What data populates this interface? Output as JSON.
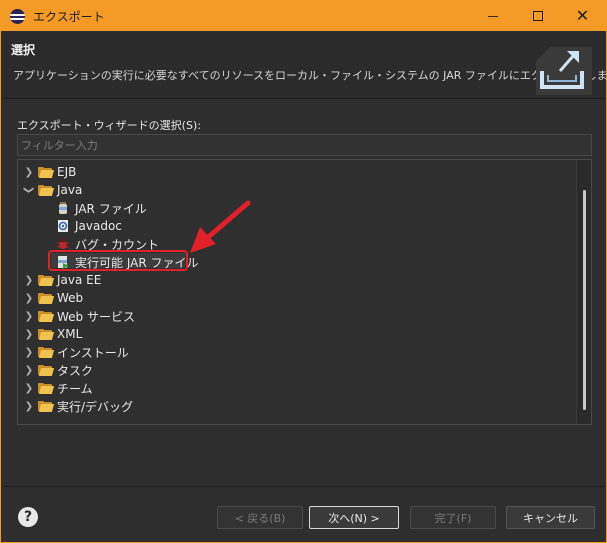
{
  "window": {
    "title": "エクスポート",
    "accent": "#f39a27",
    "minimize": "—",
    "maximize": "□",
    "close": "✕"
  },
  "header": {
    "title": "選択",
    "description": "アプリケーションの実行に必要なすべてのリソースをローカル・ファイル・システムの JAR ファイルにエクスポートします。"
  },
  "wizard": {
    "section_label": "エクスポート・ウィザードの選択(S):",
    "filter_placeholder": "フィルター入力",
    "filter_value": ""
  },
  "tree": {
    "items": [
      {
        "label": "EJB",
        "level": 0,
        "expanded": false,
        "icon": "folder-icon"
      },
      {
        "label": "Java",
        "level": 0,
        "expanded": true,
        "icon": "folder-icon"
      },
      {
        "label": "JAR ファイル",
        "level": 1,
        "icon": "jar-icon"
      },
      {
        "label": "Javadoc",
        "level": 1,
        "icon": "javadoc-icon"
      },
      {
        "label": "バグ・カウント",
        "level": 1,
        "icon": "bug-icon"
      },
      {
        "label": "実行可能 JAR ファイル",
        "level": 1,
        "icon": "runnable-jar-icon",
        "selected": true,
        "highlighted": true
      },
      {
        "label": "Java EE",
        "level": 0,
        "expanded": false,
        "icon": "folder-icon"
      },
      {
        "label": "Web",
        "level": 0,
        "expanded": false,
        "icon": "folder-icon"
      },
      {
        "label": "Web サービス",
        "level": 0,
        "expanded": false,
        "icon": "folder-icon"
      },
      {
        "label": "XML",
        "level": 0,
        "expanded": false,
        "icon": "folder-icon"
      },
      {
        "label": "インストール",
        "level": 0,
        "expanded": false,
        "icon": "folder-icon"
      },
      {
        "label": "タスク",
        "level": 0,
        "expanded": false,
        "icon": "folder-icon"
      },
      {
        "label": "チーム",
        "level": 0,
        "expanded": false,
        "icon": "folder-icon"
      },
      {
        "label": "実行/デバッグ",
        "level": 0,
        "expanded": false,
        "icon": "folder-icon"
      }
    ]
  },
  "annotation": {
    "highlight_color": "#e2202a"
  },
  "buttons": {
    "help": "?",
    "back": "< 戻る(B)",
    "next": "次へ(N) >",
    "finish": "完了(F)",
    "cancel": "キャンセル"
  }
}
